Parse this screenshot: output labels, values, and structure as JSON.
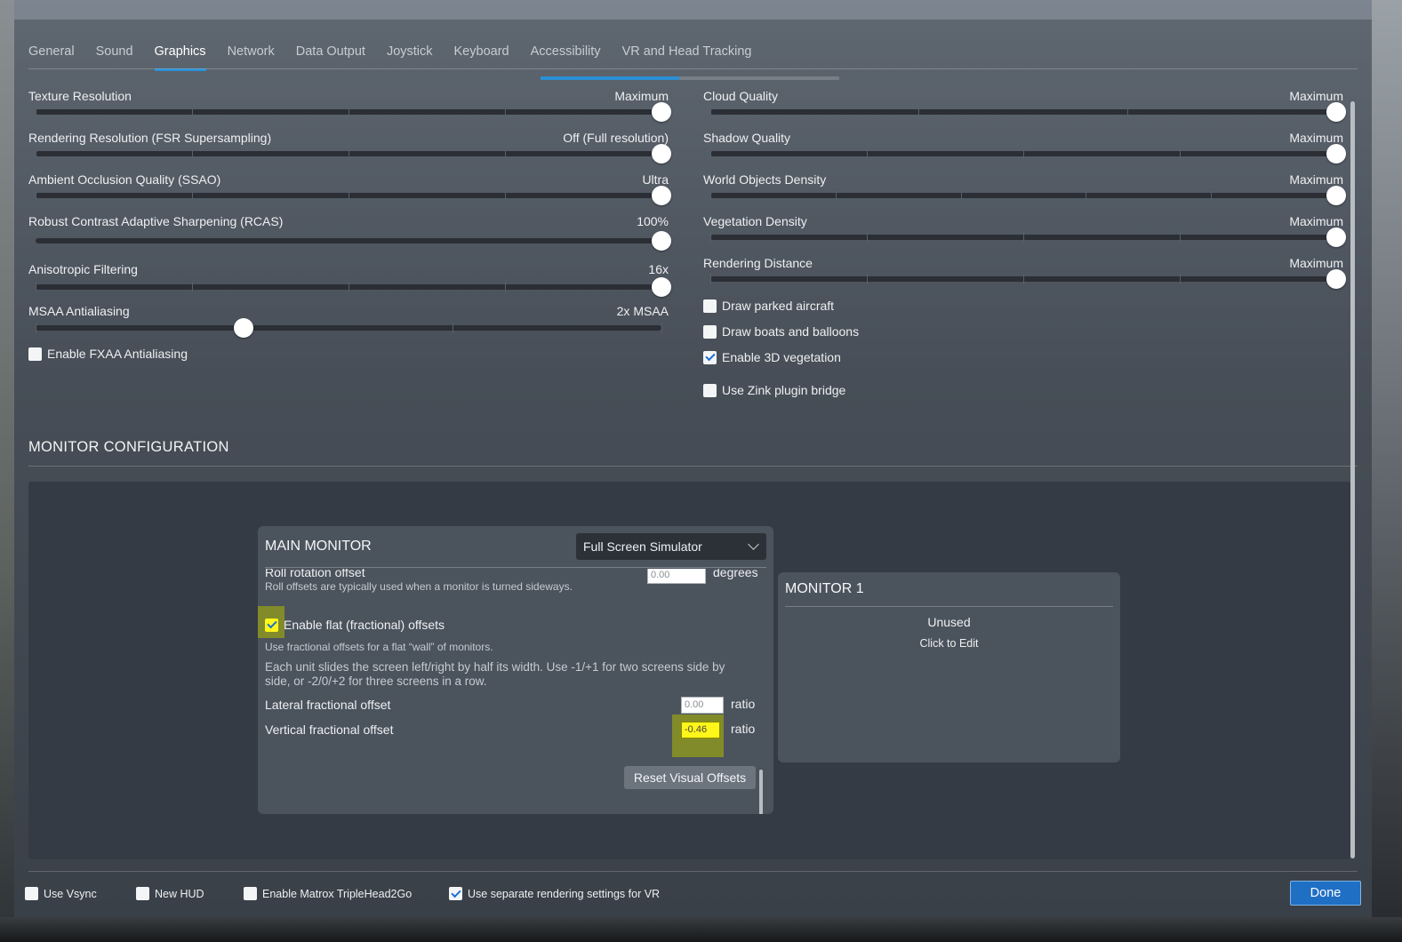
{
  "tabs": [
    {
      "label": "General"
    },
    {
      "label": "Sound"
    },
    {
      "label": "Graphics"
    },
    {
      "label": "Network"
    },
    {
      "label": "Data Output"
    },
    {
      "label": "Joystick"
    },
    {
      "label": "Keyboard"
    },
    {
      "label": "Accessibility"
    },
    {
      "label": "VR and Head Tracking"
    }
  ],
  "active_tab": "Graphics",
  "left_sliders": [
    {
      "label": "Texture Resolution",
      "value": "Maximum",
      "position": 1.0
    },
    {
      "label": "Rendering Resolution (FSR Supersampling)",
      "value": "Off (Full resolution)",
      "position": 1.0
    },
    {
      "label": "Ambient Occlusion Quality (SSAO)",
      "value": "Ultra",
      "position": 1.0
    },
    {
      "label": "Robust Contrast Adaptive Sharpening (RCAS)",
      "value": "100%",
      "position": 1.0
    },
    {
      "label": "Anisotropic Filtering",
      "value": "16x",
      "position": 1.0
    },
    {
      "label": "MSAA Antialiasing",
      "value": "2x MSAA",
      "position": 0.33
    }
  ],
  "right_sliders": [
    {
      "label": "Cloud Quality",
      "value": "Maximum",
      "position": 1.0
    },
    {
      "label": "Shadow Quality",
      "value": "Maximum",
      "position": 1.0
    },
    {
      "label": "World Objects Density",
      "value": "Maximum",
      "position": 1.0
    },
    {
      "label": "Vegetation Density",
      "value": "Maximum",
      "position": 1.0
    },
    {
      "label": "Rendering Distance",
      "value": "Maximum",
      "position": 1.0
    }
  ],
  "fxaa": {
    "label": "Enable FXAA Antialiasing",
    "checked": false
  },
  "right_checks": [
    {
      "label": "Draw parked aircraft",
      "checked": false
    },
    {
      "label": "Draw boats and balloons",
      "checked": false
    },
    {
      "label": "Enable 3D vegetation",
      "checked": true
    },
    {
      "label": "Use Zink plugin bridge",
      "checked": false
    }
  ],
  "monitor_config": {
    "section_title": "MONITOR CONFIGURATION",
    "main_monitor": {
      "title": "MAIN MONITOR",
      "mode": "Full Screen Simulator",
      "roll_label": "Roll rotation offset",
      "roll_value": "0.00",
      "roll_unit": "degrees",
      "roll_help": "Roll offsets are typically used when a monitor is turned sideways.",
      "flat_label": "Enable flat (fractional) offsets",
      "flat_checked": true,
      "flat_help": "Use fractional offsets for a flat “wall” of monitors.",
      "flat_help2": "Each unit slides the screen left/right by half its width. Use -1/+1 for two screens side by side, or -2/0/+2 for three screens in a row.",
      "lateral_label": "Lateral fractional offset",
      "lateral_value": "0.00",
      "lateral_unit": "ratio",
      "vertical_label": "Vertical fractional offset",
      "vertical_value": "-0.46",
      "vertical_unit": "ratio",
      "reset_label": "Reset Visual Offsets"
    },
    "monitor1": {
      "title": "MONITOR 1",
      "status": "Unused",
      "hint": "Click to Edit"
    }
  },
  "bottom": {
    "vsync": {
      "label": "Use Vsync",
      "checked": false
    },
    "new_hud": {
      "label": "New HUD",
      "checked": false
    },
    "matrox": {
      "label": "Enable Matrox TripleHead2Go",
      "checked": false
    },
    "vr_settings": {
      "label": "Use separate rendering settings for VR",
      "checked": true
    },
    "done_label": "Done"
  },
  "colors": {
    "accent": "#2a8fd6",
    "highlight": "#fff61a",
    "done": "#1f6fc4"
  }
}
